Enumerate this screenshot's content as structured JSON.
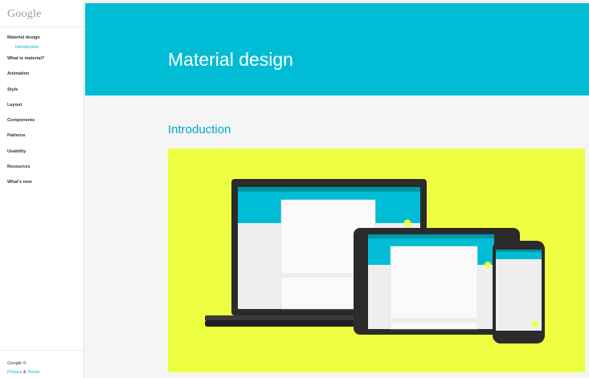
{
  "sidebar": {
    "logo": "Google",
    "items": [
      {
        "label": "Material design"
      },
      {
        "label": "Introduction"
      },
      {
        "label": "What is material?"
      },
      {
        "label": "Animation"
      },
      {
        "label": "Style"
      },
      {
        "label": "Layout"
      },
      {
        "label": "Components"
      },
      {
        "label": "Patterns"
      },
      {
        "label": "Usability"
      },
      {
        "label": "Resources"
      },
      {
        "label": "What's new"
      }
    ],
    "footer": {
      "copyright": "Google ©",
      "privacy": "Privacy",
      "amp": "&",
      "terms": "Terms"
    }
  },
  "header": {
    "title": "Material design"
  },
  "main": {
    "section_title": "Introduction",
    "hero": {
      "background": "#eeff41",
      "accent": "#00bcd4",
      "fab_color": "#eeff41",
      "devices": [
        "laptop",
        "tablet",
        "phone"
      ]
    }
  },
  "colors": {
    "header_bg": "#00bcd4",
    "link": "#00b8d4",
    "page_bg": "#f5f5f5"
  }
}
